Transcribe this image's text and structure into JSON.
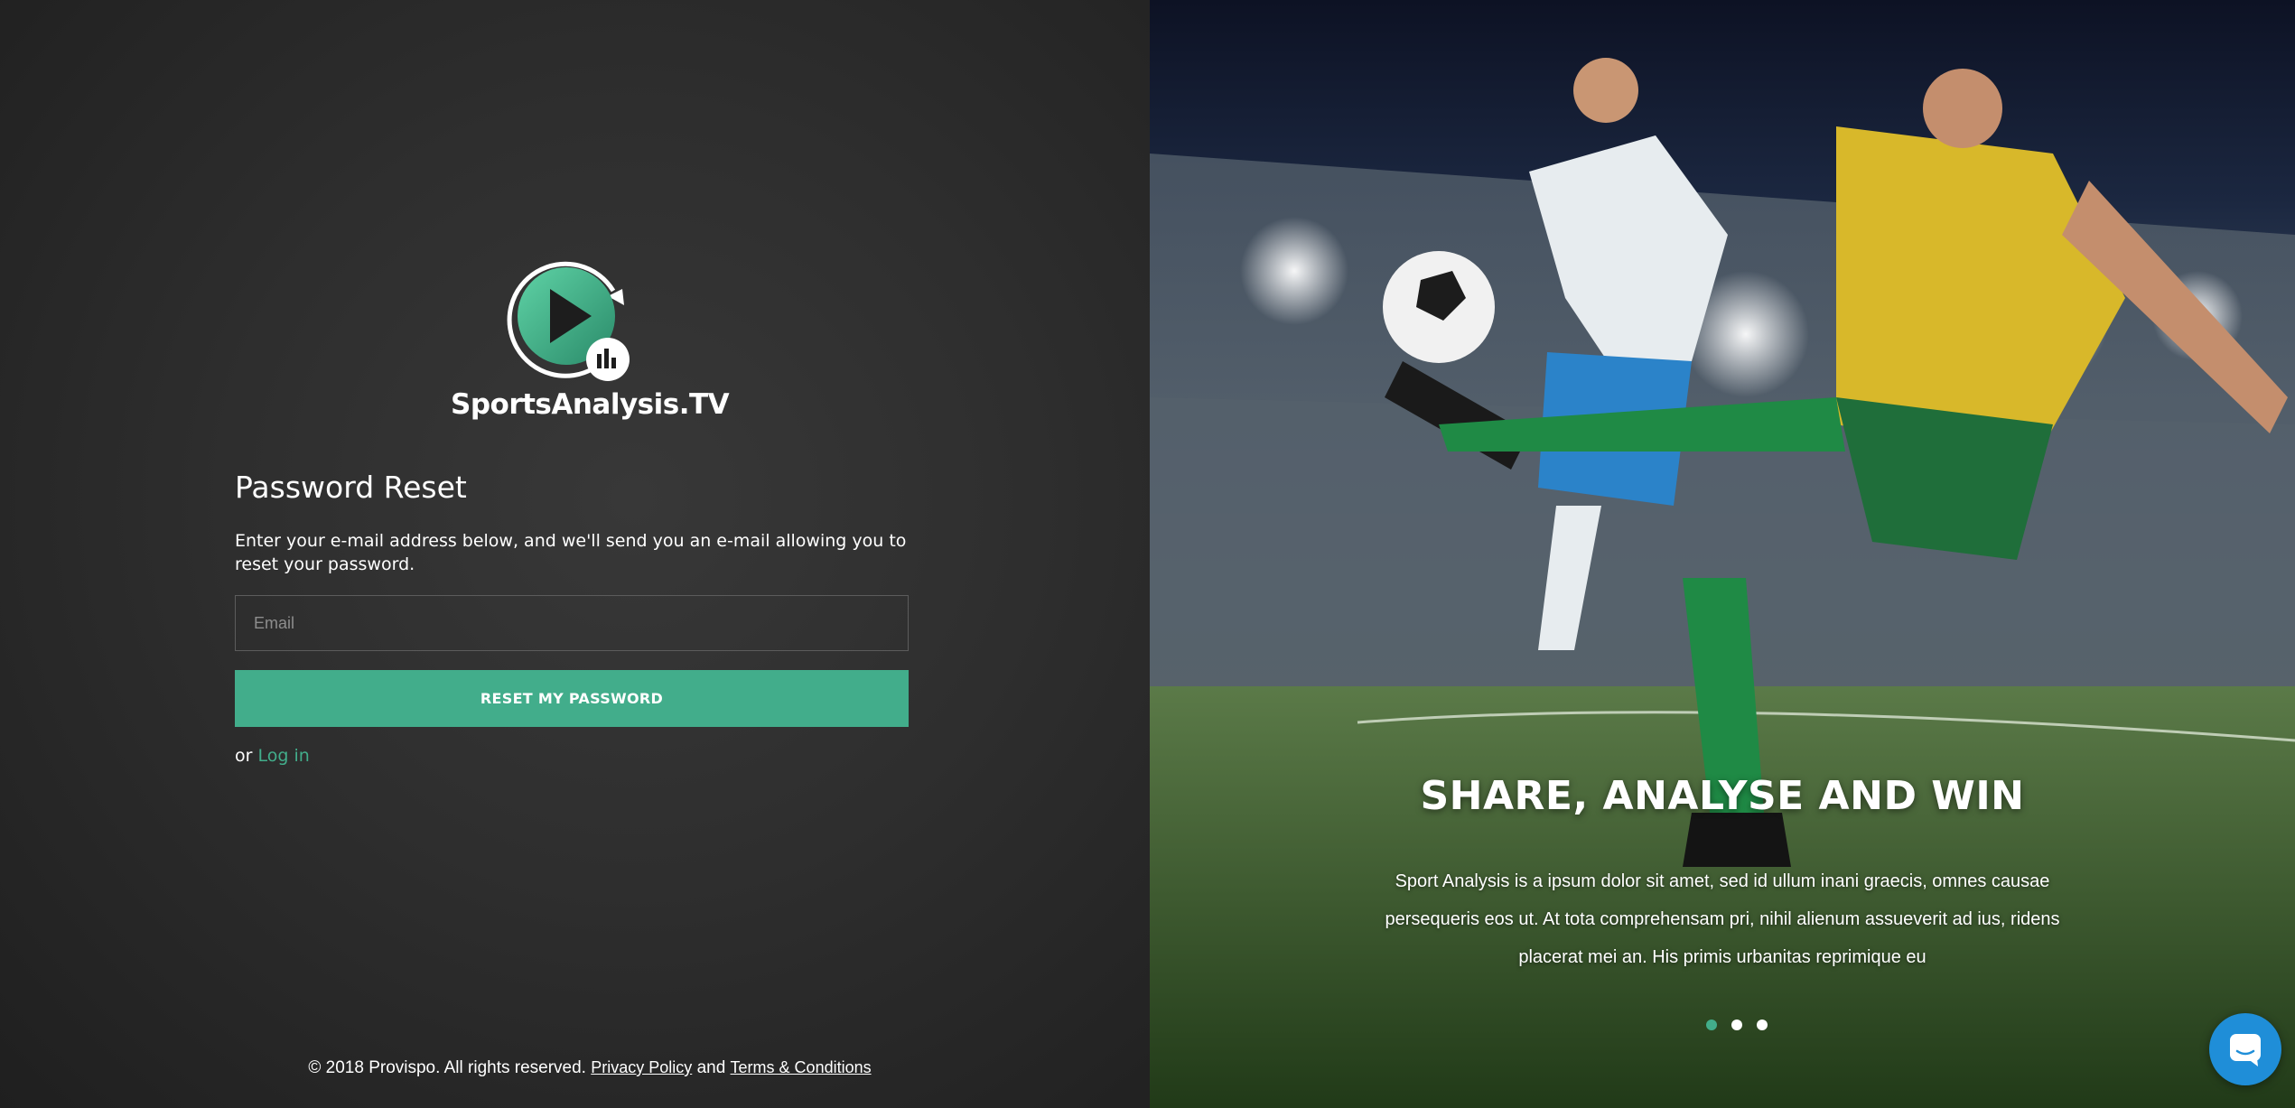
{
  "brand": {
    "name": "SportsAnalysis.TV",
    "accent_color": "#42ad8b"
  },
  "form": {
    "title": "Password Reset",
    "description": "Enter your e-mail address below, and we'll send you an e-mail allowing you to reset your password.",
    "email_placeholder": "Email",
    "email_value": "",
    "submit_label": "RESET MY PASSWORD",
    "or_text": "or",
    "login_link": "Log in"
  },
  "footer": {
    "copyright": "© 2018 Provispo. All rights reserved.",
    "privacy_label": "Privacy Policy",
    "and_text": "and",
    "terms_label": "Terms & Conditions"
  },
  "hero": {
    "title": "SHARE, ANALYSE AND WIN",
    "text": "Sport Analysis is a ipsum dolor sit amet, sed id ullum inani graecis, omnes causae persequeris eos ut. At tota comprehensam pri, nihil alienum assueverit ad ius, ridens placerat mei an. His primis urbanitas reprimique eu",
    "slides_count": 3,
    "active_slide": 1
  },
  "icons": {
    "logo": "play-circle-chart-icon",
    "chat": "chat-bubble-icon"
  }
}
